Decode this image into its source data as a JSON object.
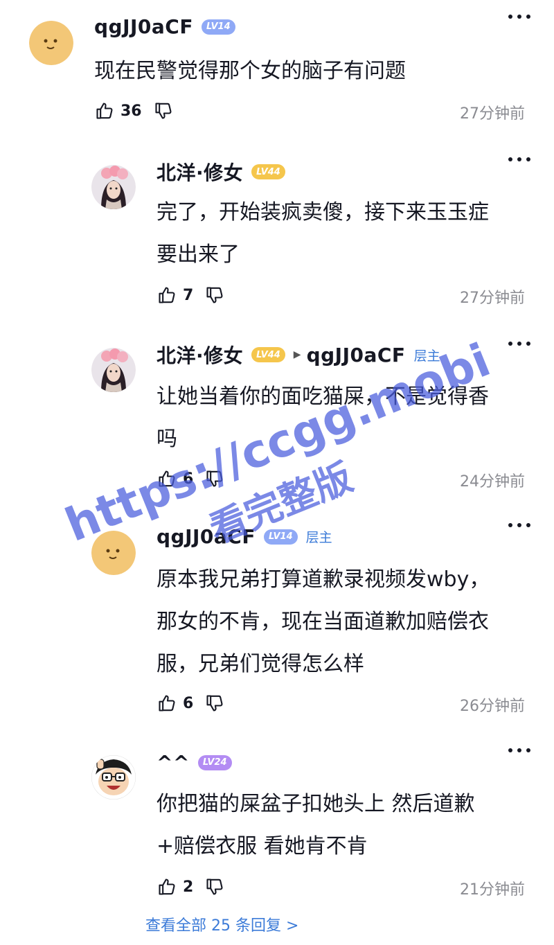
{
  "colors": {
    "lv14": "#8fa9f6",
    "lv44": "#f5c64c",
    "lv24": "#b38cf3",
    "link": "#3c7bd8",
    "time": "#8a8b91",
    "watermark": "#485cdc"
  },
  "comments": [
    {
      "username": "qgJJ0aCF",
      "level": "LV14",
      "text_lines": [
        "现在民警觉得那个女的脑子有问题"
      ],
      "likes": "36",
      "time": "27分钟前"
    },
    {
      "username": "北洋·修女",
      "level": "LV44",
      "text_lines": [
        "完了，开始装疯卖傻，接下来玉玉症",
        "要出来了"
      ],
      "likes": "7",
      "time": "27分钟前"
    },
    {
      "username": "北洋·修女",
      "level": "LV44",
      "reply_to": "qgJJ0aCF",
      "reply_to_tag": "层主",
      "text_lines": [
        "让她当着你的面吃猫屎，不是觉得香",
        "吗"
      ],
      "likes": "6",
      "time": "24分钟前"
    },
    {
      "username": "qgJJ0aCF",
      "level": "LV14",
      "op_tag": "层主",
      "text_lines": [
        "原本我兄弟打算道歉录视频发wby，",
        "那女的不肯，现在当面道歉加赔偿衣",
        "服，兄弟们觉得怎么样"
      ],
      "likes": "6",
      "time": "26分钟前"
    },
    {
      "username": "^^",
      "level": "LV24",
      "text_lines": [
        "你把猫的屎盆子扣她头上 然后道歉",
        "+赔偿衣服 看她肯不肯"
      ],
      "likes": "2",
      "time": "21分钟前"
    }
  ],
  "view_all": "查看全部 25 条回复 >",
  "watermark": {
    "line1": "https://ccgg.mobi",
    "line2": "看完整版"
  }
}
